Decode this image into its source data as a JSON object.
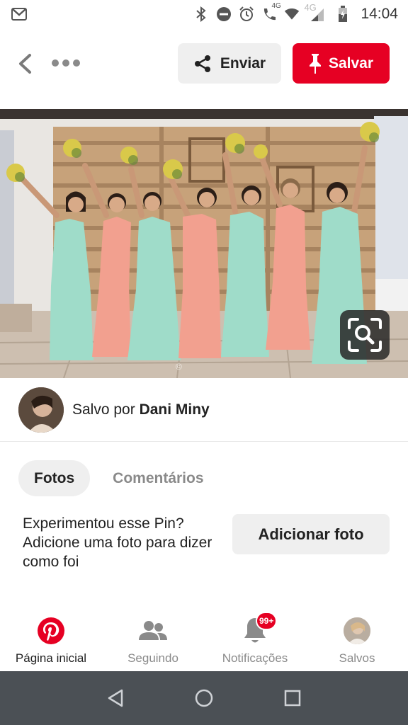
{
  "status_bar": {
    "time": "14:04",
    "network_4g_a": "4G",
    "network_4g_b": "4G",
    "icons": [
      "gmail-icon",
      "bluetooth-icon",
      "dnd-icon",
      "alarm-icon",
      "call-icon",
      "wifi-icon",
      "signal-icon",
      "battery-icon"
    ]
  },
  "top_actions": {
    "send_label": "Enviar",
    "save_label": "Salvar"
  },
  "pin": {
    "watermark": "©"
  },
  "saved_by": {
    "prefix": "Salvo por",
    "user": "Dani Miny"
  },
  "tabs": [
    {
      "label": "Fotos",
      "active": true
    },
    {
      "label": "Comentários",
      "active": false
    }
  ],
  "tried_it": {
    "text": "Experimentou esse Pin? Adicione uma foto para dizer como foi",
    "button_label": "Adicionar foto"
  },
  "bottom_nav": [
    {
      "label": "Página inicial",
      "icon": "pinterest-icon",
      "active": true
    },
    {
      "label": "Seguindo",
      "icon": "people-icon",
      "active": false
    },
    {
      "label": "Notificações",
      "icon": "bell-icon",
      "active": false,
      "badge": "99+"
    },
    {
      "label": "Salvos",
      "icon": "profile-avatar",
      "active": false
    }
  ],
  "colors": {
    "brand_red": "#e60023",
    "button_gray": "#efefef",
    "muted_text": "#8a8a8a",
    "android_nav": "#4b5055",
    "dress_mint": "#9fdcc9",
    "dress_coral": "#f2a08f"
  }
}
